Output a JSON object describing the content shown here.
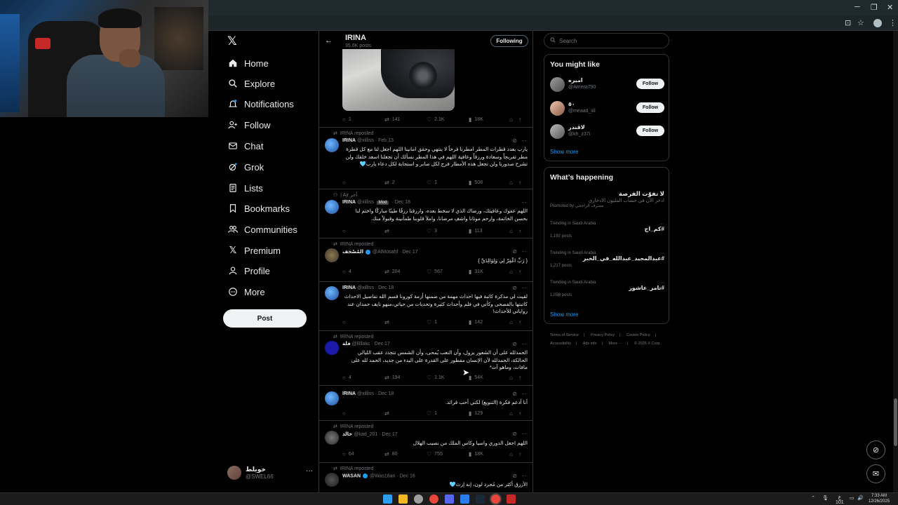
{
  "browser": {
    "window_controls": [
      "─",
      "❐",
      "✕"
    ]
  },
  "nav": {
    "items": [
      {
        "label": "Home",
        "icon": "home-icon"
      },
      {
        "label": "Explore",
        "icon": "search-icon"
      },
      {
        "label": "Notifications",
        "icon": "bell-icon"
      },
      {
        "label": "Follow",
        "icon": "add-person-icon"
      },
      {
        "label": "Chat",
        "icon": "mail-icon"
      },
      {
        "label": "Grok",
        "icon": "grok-icon"
      },
      {
        "label": "Lists",
        "icon": "list-icon"
      },
      {
        "label": "Bookmarks",
        "icon": "bookmark-icon"
      },
      {
        "label": "Communities",
        "icon": "people-icon"
      },
      {
        "label": "Premium",
        "icon": "x-logo-icon"
      },
      {
        "label": "Profile",
        "icon": "person-icon"
      },
      {
        "label": "More",
        "icon": "more-circle-icon"
      }
    ],
    "post_label": "Post",
    "account": {
      "name": "خويلط",
      "handle": "@SWEL66",
      "more": "···"
    }
  },
  "profile_header": {
    "name": "IRINA",
    "posts_count": "35.6K posts",
    "following_label": "Following"
  },
  "top_post_actions": {
    "replies": "1",
    "reposts": "141",
    "likes": "2.1K",
    "views": "18K"
  },
  "tweets": [
    {
      "reposted_by": "IRINA reposted",
      "name": "IRINA",
      "handle": "@xilliss",
      "date": "· Feb 13",
      "text": "يارب بعدد قطرات المطر امطرنا فرحاً لا ينتهي وحقق امانينا اللهم اجعل لنا مع كل قطرة مطر تفريجاً وسعادة ورزقاً وعافية اللهم في هذا المطر نسألك أن تجعلنا اسعد خلقك ولن تشرح صدورنا ولن تجعل هذه الأمطار فرج لكل صابر و استجابة لكل دعاء يارب🩵",
      "replies": "",
      "reposts": "2",
      "likes": "1",
      "views": "508"
    },
    {
      "reposted_by": "| Ajr أجر",
      "name": "IRINA",
      "handle": "@xilliss",
      "badge": "Mod",
      "date": "· Dec 18",
      "text": "اللهم عفوك وعافيتك، ورضاك الذي لا سخط بعده، وارزقنا رزقًا طيبًا مباركًا واختم لنا بحسن الخاتمة، وارحم موتانا واشفِ مرضانا، واملأ قلوبنا طمأنينة وقبولاً منك.",
      "replies": "",
      "reposts": "",
      "likes": "3",
      "views": "113"
    },
    {
      "reposted_by": "IRINA reposted",
      "name": "المُصْحَف",
      "handle": "@AlMosahf",
      "date": "· Dec 17",
      "verified": true,
      "text": "{ رَبِّ اغْفِرْ لِي وَلِوَالِدَيَّ }",
      "replies": "4",
      "reposts": "204",
      "likes": "567",
      "views": "31K"
    },
    {
      "reposted_by": "",
      "name": "IRINA",
      "handle": "@xilliss",
      "date": "· Dec 18",
      "text": "لقيت لي مذكرة كاتبة فيها احداث مهمة من ضمنها أزمة كورونا قسم الله تفاصيل الاحداث كاتبتها بالفصحى وكأني في فلم وأحداث كثيرة وتحديات من حياتي،منهو نايف حمدان عند رواياتي للأحداث!",
      "replies": "",
      "reposts": "",
      "likes": "1",
      "views": "142"
    },
    {
      "reposted_by": "IRINA reposted",
      "name": "فلة",
      "handle": "@Bllakc",
      "date": "· Dec 17",
      "text": "الحمدلله على أن الشعور يزول، وأن التعب يُمحى، وأن الشمس تتجدد عقب الليالي الحالكة، الحمدلله لأن الإنسان مفطور على القدرة على البدء من جديد، الحمد لله على مافات، وماهو آت*",
      "replies": "4",
      "reposts": "194",
      "likes": "1.1K",
      "views": "54K"
    },
    {
      "reposted_by": "",
      "name": "IRINA",
      "handle": "@xilliss",
      "date": "· Dec 18",
      "text": "أنا أدعم فكرة (التنويع) لكني أحب قرائد.",
      "replies": "",
      "reposts": "",
      "likes": "1",
      "views": "129"
    },
    {
      "reposted_by": "IRINA reposted",
      "name": "خالد",
      "handle": "@kad_201",
      "date": "· Dec 17",
      "text": "اللهم اجعل الدوري واسيا وكاس الملك من نصيب الهلال",
      "replies": "64",
      "reposts": "80",
      "likes": "755",
      "views": "18K"
    },
    {
      "reposted_by": "IRINA reposted",
      "name": "WASAN",
      "handle": "@Was16an",
      "date": "· Dec 16",
      "verified": true,
      "text": "الأزرق أكثر من مُجرد لون، إنه إرث🩵",
      "replies": "",
      "reposts": "",
      "likes": "",
      "views": ""
    }
  ],
  "search": {
    "placeholder": "Search"
  },
  "you_might_like": {
    "title": "You might like",
    "users": [
      {
        "name": "اميره",
        "handle": "@Amera790",
        "follow": "Follow"
      },
      {
        "name": "٥٠",
        "handle": "@meaad_iiil",
        "follow": "Follow"
      },
      {
        "name": "لاڤندر",
        "handle": "@kh_z37i",
        "follow": "Follow"
      }
    ],
    "show_more": "Show more"
  },
  "whats_happening": {
    "title": "What’s happening",
    "promo": {
      "title": "لا تفوّت الفرصة",
      "desc": "ادخر الآن في حساب المليون الادخاري",
      "promoted": "Promoted by مصرف الراجحي"
    },
    "trends": [
      {
        "context": "Trending in Saudi Arabia",
        "title": "#كم_اج",
        "posts": "1,192 posts"
      },
      {
        "context": "Trending in Saudi Arabia",
        "title": "#عبدالمجيد_عبدالله_في_الخبر",
        "posts": "1,217 posts"
      },
      {
        "context": "Trending in Saudi Arabia",
        "title": "#تامر_عاشور",
        "posts": "1,058 posts"
      }
    ],
    "show_more": "Show more"
  },
  "footer": {
    "links": [
      "Terms of Service",
      "|",
      "Privacy Policy",
      "|",
      "Cookie Policy",
      "|",
      "Accessibility",
      "|",
      "Ads info",
      "|",
      "More ···",
      "|",
      "© 2025 X Corp."
    ]
  },
  "taskbar": {
    "time": "7:33 AM",
    "date": "12/26/2025",
    "lang": "ع",
    "lang_sub": "101"
  },
  "colors": {
    "background": "#000000",
    "text": "#e7e9ea",
    "muted": "#71767b",
    "accent": "#1d9bf0",
    "border": "#2f3336"
  }
}
